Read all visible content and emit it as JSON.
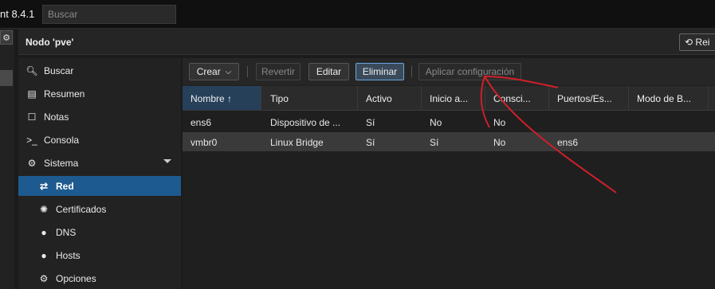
{
  "app": {
    "title": "nt 8.4.1",
    "search_placeholder": "Buscar"
  },
  "node": {
    "title": "Nodo 'pve'",
    "reboot_label": "Rei"
  },
  "sidebar": {
    "items": [
      {
        "label": "Buscar",
        "icon": "search-icon"
      },
      {
        "label": "Resumen",
        "icon": "book-icon"
      },
      {
        "label": "Notas",
        "icon": "note-icon"
      },
      {
        "label": "Consola",
        "icon": "terminal-icon"
      },
      {
        "label": "Sistema",
        "icon": "cogs-icon"
      },
      {
        "label": "Red",
        "icon": "exchange-icon"
      },
      {
        "label": "Certificados",
        "icon": "certificate-icon"
      },
      {
        "label": "DNS",
        "icon": "globe-icon"
      },
      {
        "label": "Hosts",
        "icon": "globe-icon"
      },
      {
        "label": "Opciones",
        "icon": "gear-icon"
      }
    ]
  },
  "toolbar": {
    "create": "Crear",
    "revert": "Revertir",
    "edit": "Editar",
    "delete": "Eliminar",
    "apply": "Aplicar configuración"
  },
  "grid": {
    "columns": [
      "Nombre ↑",
      "Tipo",
      "Activo",
      "Inicio a...",
      "Consci...",
      "Puertos/Es...",
      "Modo de B..."
    ],
    "rows": [
      [
        "ens6",
        "Dispositivo de ...",
        "Sí",
        "No",
        "No",
        "",
        ""
      ],
      [
        "vmbr0",
        "Linux Bridge",
        "Sí",
        "Sí",
        "No",
        "ens6",
        ""
      ]
    ]
  },
  "colors": {
    "accent": "#1d5a8f",
    "annotation": "#d0202a"
  }
}
